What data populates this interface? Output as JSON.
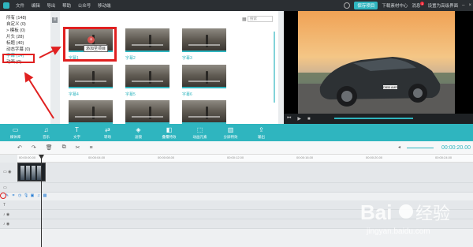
{
  "titlebar": {
    "menu": [
      "文件",
      "编辑",
      "导出",
      "帮助",
      "公众号",
      "移动端"
    ],
    "save_project": "保存项目",
    "download_assets": "下载素材中心",
    "messages": "消息",
    "message_count": "1",
    "switch_mode": "设置为高级界面",
    "accent": "#2fb5bf"
  },
  "categories": [
    {
      "label": "所有 (148)"
    },
    {
      "label": "自定义 (0)"
    },
    {
      "label": "> 模板 (0)"
    },
    {
      "label": "片头 (28)"
    },
    {
      "label": "标题 (40)"
    },
    {
      "label": "动态字幕 (0)"
    },
    {
      "label": "字幕 (14)"
    },
    {
      "label": "动画 (0)"
    }
  ],
  "grid": {
    "search_placeholder": "搜索",
    "thumbs": [
      {
        "label": "字幕1"
      },
      {
        "label": "字幕2"
      },
      {
        "label": "字幕3"
      },
      {
        "label": "字幕4"
      },
      {
        "label": "字幕5"
      },
      {
        "label": "字幕6"
      },
      {
        "label": "字幕7"
      },
      {
        "label": "字幕8"
      },
      {
        "label": "字幕9"
      }
    ],
    "add_tooltip": "添加至项目"
  },
  "preview": {
    "plate": "DB55 AMR"
  },
  "toolbar": [
    {
      "label": "媒体库",
      "icon": "folder-icon"
    },
    {
      "label": "音乐",
      "icon": "music-icon"
    },
    {
      "label": "文字",
      "icon": "text-icon"
    },
    {
      "label": "转场",
      "icon": "transition-icon"
    },
    {
      "label": "滤镜",
      "icon": "filter-icon"
    },
    {
      "label": "叠覆特效",
      "icon": "overlay-icon"
    },
    {
      "label": "动画元素",
      "icon": "element-icon"
    },
    {
      "label": "分屏特效",
      "icon": "splitscreen-icon"
    },
    {
      "label": "输出",
      "icon": "export-icon"
    }
  ],
  "timeline": {
    "timecode": "00:00:20.00",
    "ruler": [
      "00:00:00.00",
      "00:00:04.00",
      "00:00:08.00",
      "00:00:12.00",
      "00:00:16.00",
      "00:00:20.00",
      "00:00:24.00"
    ]
  },
  "watermark": {
    "brand": "Bai",
    "brand2": "经验",
    "url": "jingyan.baidu.com"
  }
}
